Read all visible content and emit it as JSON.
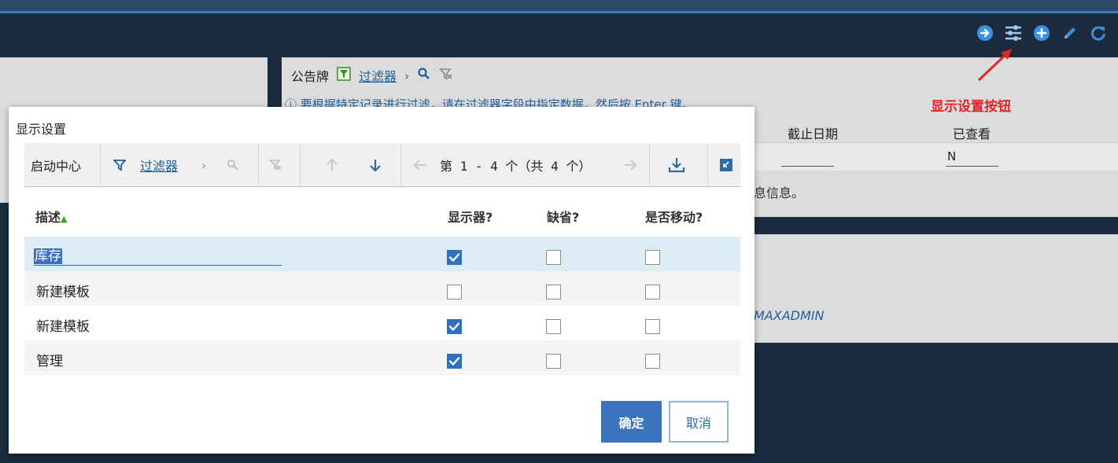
{
  "header": {
    "toolbar_icons": [
      "arrow-right-circle-icon",
      "sliders-icon",
      "plus-circle-icon",
      "pencil-icon",
      "refresh-icon"
    ]
  },
  "background": {
    "breadcrumb": {
      "app": "公告牌",
      "filter_link": "过滤器"
    },
    "info_text": "要根据特定记录进行过滤，请在过滤器字段中指定数据，然后按 Enter 键。",
    "columns": [
      "截止日期",
      "已查看"
    ],
    "viewed_value": "N",
    "message_tail": "息信息。",
    "user": "MAXADMIN"
  },
  "annotation": {
    "label": "显示设置按钮",
    "color": "#e3262a"
  },
  "dialog": {
    "title": "显示设置",
    "toolbar": {
      "app": "启动中心",
      "filter_link": "过滤器",
      "pager": "第 1 - 4 个（共 4 个）"
    },
    "columns": {
      "desc": "描述",
      "display": "显示器?",
      "default": "缺省?",
      "mobile": "是否移动?"
    },
    "rows": [
      {
        "desc": "库存",
        "display": true,
        "default": false,
        "mobile": false
      },
      {
        "desc": "新建模板",
        "display": false,
        "default": false,
        "mobile": false
      },
      {
        "desc": "新建模板",
        "display": true,
        "default": false,
        "mobile": false
      },
      {
        "desc": "管理",
        "display": true,
        "default": false,
        "mobile": false
      }
    ],
    "ok_label": "确定",
    "cancel_label": "取消"
  },
  "colors": {
    "accent": "#3a74bd",
    "header_bg": "#1b2c3f",
    "selected_row": "#dcedf6"
  }
}
